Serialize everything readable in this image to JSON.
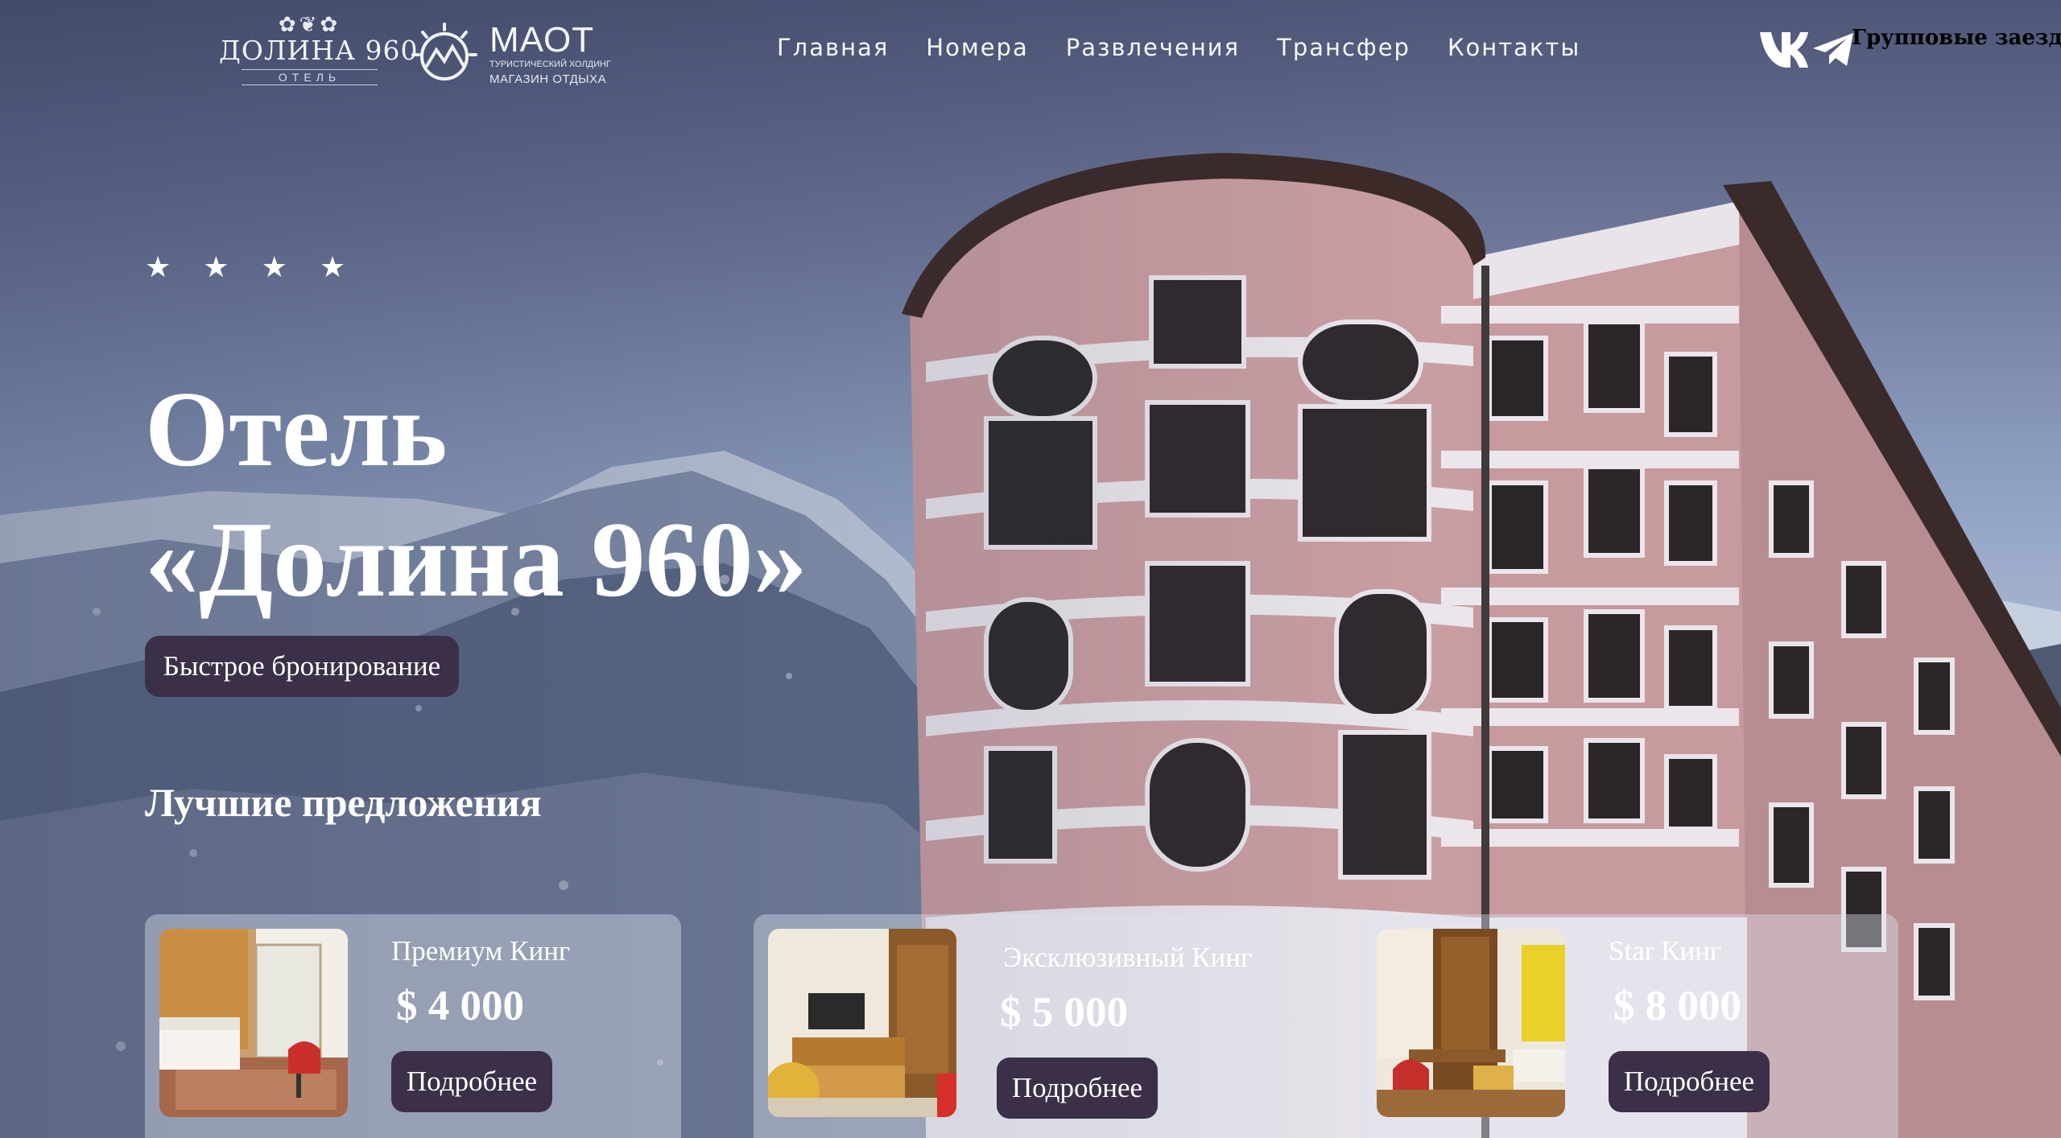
{
  "header": {
    "logo_dolina": {
      "ornament": "✿❦✿",
      "name": "ДОЛИНА 960",
      "sub": "ОТЕЛЬ"
    },
    "logo_maot": {
      "title": "МАОТ",
      "line1": "ТУРИСТИЧЕСКИЙ ХОЛДИНГ",
      "line2": "МАГАЗИН ОТДЫХА"
    },
    "nav": [
      {
        "label": "Главная"
      },
      {
        "label": "Номера"
      },
      {
        "label": "Развлечения"
      },
      {
        "label": "Трансфер"
      },
      {
        "label": "Контакты"
      }
    ],
    "social": {
      "vk_icon": "vk-icon",
      "telegram_icon": "telegram-icon"
    },
    "group_link": "Групповые заезды"
  },
  "hero": {
    "stars": [
      "★",
      "★",
      "★",
      "★"
    ],
    "title_line1": "Отель",
    "title_line2": "«Долина 960»",
    "book_button": "Быстрое бронирование",
    "offers_heading": "Лучшие предложения"
  },
  "offers": [
    {
      "name": "Премиум Кинг",
      "price": "$ 4 000",
      "button": "Подробнее"
    },
    {
      "name": "Эксклюзивный Кинг",
      "price": "$ 5 000",
      "button": "Подробнее"
    },
    {
      "name": "Star Кинг",
      "price": "$ 8 000",
      "button": "Подробнее"
    }
  ],
  "colors": {
    "button_bg": "#3b3047",
    "sky_top": "#4f5677",
    "building_wall": "#c79a9e",
    "trim": "#e9e4ea"
  }
}
